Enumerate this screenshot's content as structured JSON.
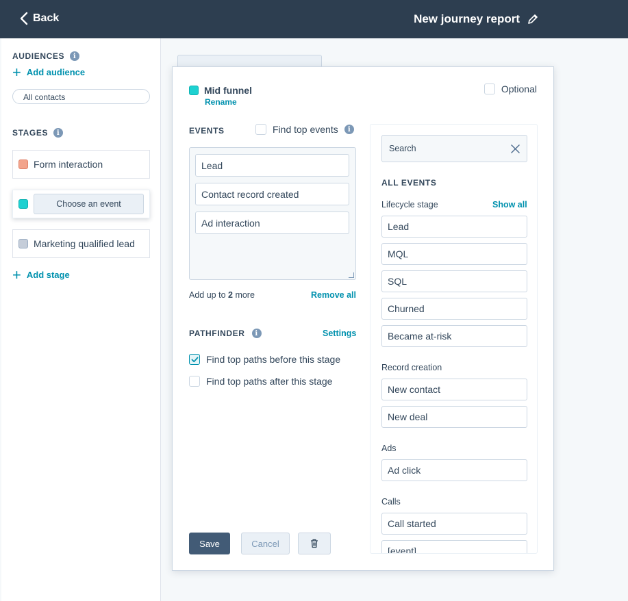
{
  "header": {
    "back_label": "Back",
    "title": "New journey report"
  },
  "sidebar": {
    "audiences_label": "AUDIENCES",
    "add_audience_label": "Add audience",
    "audience_pill": "All contacts",
    "stages_label": "STAGES",
    "stages": [
      {
        "label": "Form interaction",
        "color": "#f2a48c"
      },
      {
        "label": "Choose an event",
        "color": "#1ed1d1"
      },
      {
        "label": "Marketing qualified lead",
        "color": "#c5cdd9"
      }
    ],
    "add_stage_label": "Add stage"
  },
  "panel": {
    "stage_name": "Mid funnel",
    "stage_color": "#1ed1d1",
    "rename_label": "Rename",
    "optional_label": "Optional",
    "events_label": "EVENTS",
    "find_top_events_label": "Find top events",
    "selected_events": [
      "Lead",
      "Contact record created",
      "Ad interaction"
    ],
    "add_up_prefix": "Add up to",
    "add_up_count": "2",
    "add_up_suffix": "more",
    "remove_all_label": "Remove all",
    "pathfinder_label": "PATHFINDER",
    "settings_label": "Settings",
    "path_options": [
      {
        "label": "Find top paths before this stage",
        "checked": true
      },
      {
        "label": "Find top paths after this stage",
        "checked": false
      }
    ],
    "save_label": "Save",
    "cancel_label": "Cancel"
  },
  "event_picker": {
    "search_placeholder": "Search",
    "all_events_label": "ALL EVENTS",
    "show_all_label": "Show all",
    "groups": [
      {
        "label": "Lifecycle stage",
        "items": [
          "Lead",
          "MQL",
          "SQL",
          "Churned",
          "Became at-risk"
        ]
      },
      {
        "label": "Record creation",
        "items": [
          "New contact",
          "New deal"
        ]
      },
      {
        "label": "Ads",
        "items": [
          "Ad click"
        ]
      },
      {
        "label": "Calls",
        "items": [
          "Call started",
          "[event]"
        ]
      }
    ]
  },
  "colors": {
    "header_bg": "#2d3e50",
    "accent": "#0091ae",
    "save_button": "#425b76"
  }
}
